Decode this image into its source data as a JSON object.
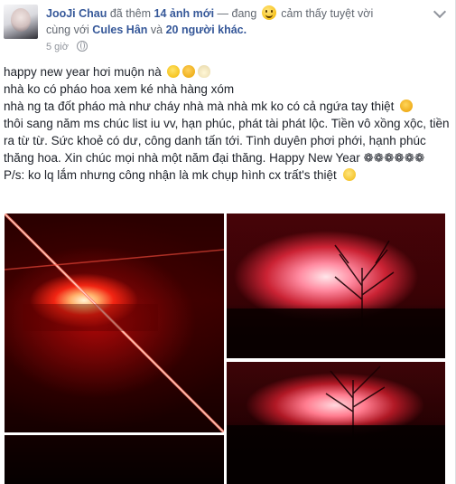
{
  "post": {
    "author": "JooJi Chau",
    "action": "đã thêm",
    "photos_added": "14 ảnh mới",
    "dash": "— đang",
    "feeling_emoji": "smiley-icon",
    "feeling": "cảm thấy tuyệt vời",
    "with_prefix": "cùng với",
    "tagged": "Cules Hân",
    "and": "và",
    "others": "20 người khác.",
    "time": "5 giờ",
    "privacy_icon": "globe-icon",
    "menu_icon": "chevron-down-icon"
  },
  "content": {
    "line1": "happy new year hơi muộn nà",
    "line2": "nhà ko có pháo hoa xem ké nhà hàng xóm",
    "line3a": "nhà ng ta đốt pháo mà như cháy nhà mà nhà mk ko có cả ngứa tay thiệt",
    "line3b": "thôi sang năm ms chúc list iu vv, hạn phúc, phát tài phát lộc. Tiền vô xồng xộc, tiền ra từ từ. Sức khoẻ có dư, công danh tấn tới. Tình duyên phơi phới, hạnh phúc thăng hoa. Xin chúc mọi nhà một năm đại thăng. Happy New Year ❁❁❁❁❁❁",
    "line4": "P/s: ko lq lắm nhưng công nhận là mk chụp hình cx trất's thiệt"
  },
  "photos": [
    {
      "name": "firework-photo-1"
    },
    {
      "name": "firework-photo-2"
    },
    {
      "name": "firework-photo-3"
    },
    {
      "name": "firework-photo-4"
    }
  ],
  "colors": {
    "link": "#365899",
    "text": "#1d2129",
    "meta": "#90949c"
  }
}
